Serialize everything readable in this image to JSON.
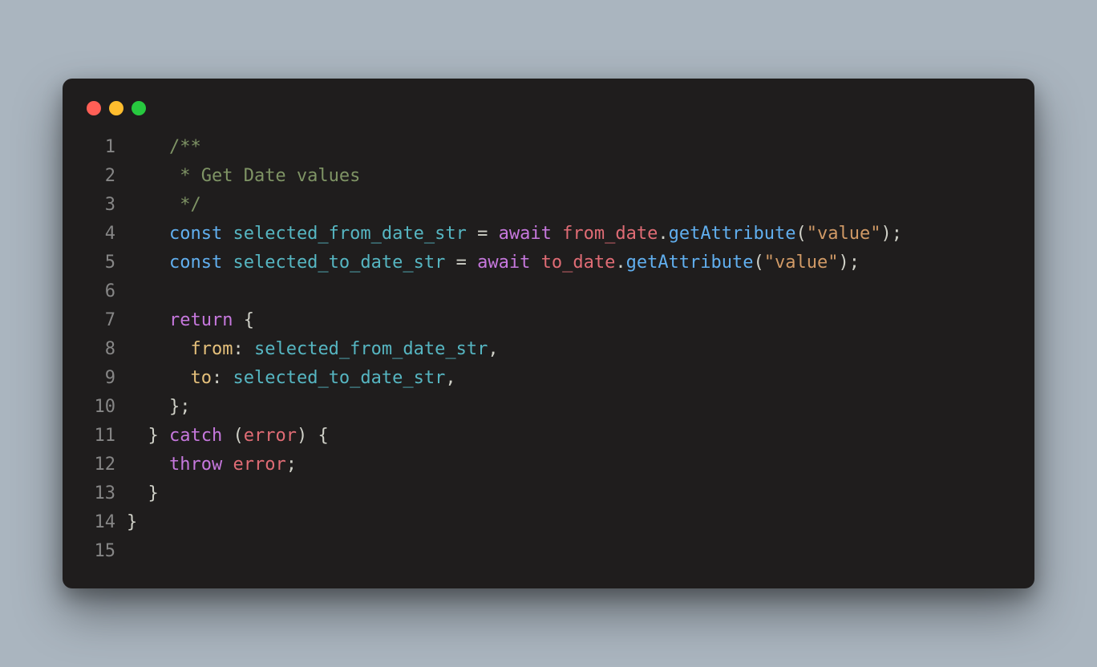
{
  "window": {
    "traffic_lights": [
      "red",
      "yellow",
      "green"
    ]
  },
  "code": {
    "lines": [
      {
        "n": "1",
        "indent": "    ",
        "tokens": [
          [
            "comment",
            "/**"
          ]
        ]
      },
      {
        "n": "2",
        "indent": "    ",
        "tokens": [
          [
            "comment",
            " * Get Date values"
          ]
        ]
      },
      {
        "n": "3",
        "indent": "    ",
        "tokens": [
          [
            "comment",
            " */"
          ]
        ]
      },
      {
        "n": "4",
        "indent": "    ",
        "tokens": [
          [
            "constkw",
            "const"
          ],
          [
            "punct",
            " "
          ],
          [
            "decl",
            "selected_from_date_str"
          ],
          [
            "punct",
            " "
          ],
          [
            "punct",
            "="
          ],
          [
            "punct",
            " "
          ],
          [
            "kw",
            "await"
          ],
          [
            "punct",
            " "
          ],
          [
            "ident",
            "from_date"
          ],
          [
            "punct",
            "."
          ],
          [
            "fn",
            "getAttribute"
          ],
          [
            "punct",
            "("
          ],
          [
            "str",
            "\"value\""
          ],
          [
            "punct",
            ");"
          ]
        ]
      },
      {
        "n": "5",
        "indent": "    ",
        "tokens": [
          [
            "constkw",
            "const"
          ],
          [
            "punct",
            " "
          ],
          [
            "decl",
            "selected_to_date_str"
          ],
          [
            "punct",
            " "
          ],
          [
            "punct",
            "="
          ],
          [
            "punct",
            " "
          ],
          [
            "kw",
            "await"
          ],
          [
            "punct",
            " "
          ],
          [
            "ident",
            "to_date"
          ],
          [
            "punct",
            "."
          ],
          [
            "fn",
            "getAttribute"
          ],
          [
            "punct",
            "("
          ],
          [
            "str",
            "\"value\""
          ],
          [
            "punct",
            ");"
          ]
        ]
      },
      {
        "n": "6",
        "indent": "",
        "tokens": []
      },
      {
        "n": "7",
        "indent": "    ",
        "tokens": [
          [
            "kw",
            "return"
          ],
          [
            "punct",
            " {"
          ]
        ]
      },
      {
        "n": "8",
        "indent": "      ",
        "tokens": [
          [
            "attr",
            "from"
          ],
          [
            "punct",
            ": "
          ],
          [
            "decl",
            "selected_from_date_str"
          ],
          [
            "punct",
            ","
          ]
        ]
      },
      {
        "n": "9",
        "indent": "      ",
        "tokens": [
          [
            "attr",
            "to"
          ],
          [
            "punct",
            ": "
          ],
          [
            "decl",
            "selected_to_date_str"
          ],
          [
            "punct",
            ","
          ]
        ]
      },
      {
        "n": "10",
        "indent": "    ",
        "tokens": [
          [
            "punct",
            "};"
          ]
        ]
      },
      {
        "n": "11",
        "indent": "  ",
        "tokens": [
          [
            "punct",
            "} "
          ],
          [
            "kw",
            "catch"
          ],
          [
            "punct",
            " ("
          ],
          [
            "ident",
            "error"
          ],
          [
            "punct",
            ") {"
          ]
        ]
      },
      {
        "n": "12",
        "indent": "    ",
        "tokens": [
          [
            "kw",
            "throw"
          ],
          [
            "punct",
            " "
          ],
          [
            "ident",
            "error"
          ],
          [
            "punct",
            ";"
          ]
        ]
      },
      {
        "n": "13",
        "indent": "  ",
        "tokens": [
          [
            "punct",
            "}"
          ]
        ]
      },
      {
        "n": "14",
        "indent": "",
        "tokens": [
          [
            "punct",
            "}"
          ]
        ]
      },
      {
        "n": "15",
        "indent": "",
        "tokens": []
      }
    ]
  }
}
